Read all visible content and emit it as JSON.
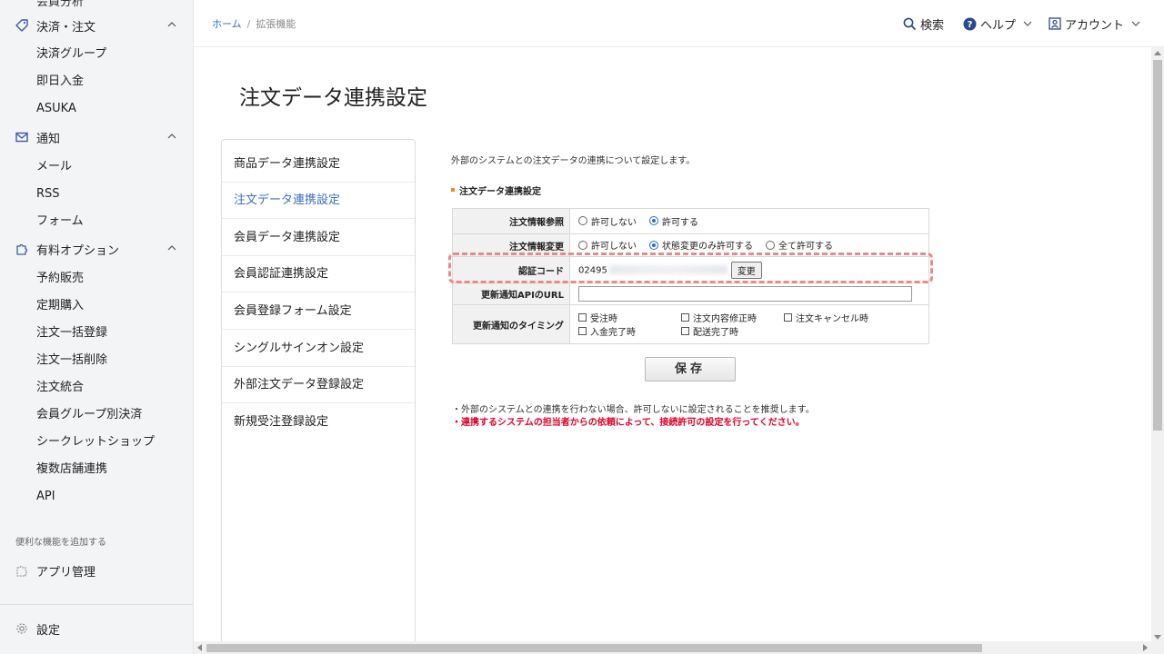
{
  "sidebar": {
    "top_cut": "会員分析",
    "groups": [
      {
        "label": "決済・注文",
        "icon": "tag-icon",
        "items": [
          "決済グループ",
          "即日入金",
          "ASUKA"
        ]
      },
      {
        "label": "通知",
        "icon": "mail-icon",
        "items": [
          "メール",
          "RSS",
          "フォーム"
        ]
      },
      {
        "label": "有料オプション",
        "icon": "puzzle-icon",
        "items": [
          "予約販売",
          "定期購入",
          "注文一括登録",
          "注文一括削除",
          "注文統合",
          "会員グループ別決済",
          "シークレットショップ",
          "複数店舗連携",
          "API"
        ]
      }
    ],
    "section_label": "便利な機能を追加する",
    "app_manage": "アプリ管理",
    "settings": "設定"
  },
  "header": {
    "breadcrumb_home": "ホーム",
    "breadcrumb_sep": "/",
    "breadcrumb_current": "拡張機能",
    "search": "検索",
    "help": "ヘルプ",
    "account": "アカウント"
  },
  "page": {
    "title": "注文データ連携設定"
  },
  "subnav": {
    "items": [
      "商品データ連携設定",
      "注文データ連携設定",
      "会員データ連携設定",
      "会員認証連携設定",
      "会員登録フォーム設定",
      "シングルサインオン設定",
      "外部注文データ登録設定",
      "新規受注登録設定"
    ],
    "active_index": 1
  },
  "content": {
    "intro": "外部のシステムとの注文データの連携について設定します。",
    "section_title": "注文データ連携設定",
    "rows": {
      "reference": {
        "label": "注文情報参照",
        "options": [
          "許可しない",
          "許可する"
        ],
        "selected": 1
      },
      "change": {
        "label": "注文情報変更",
        "options": [
          "許可しない",
          "状態変更のみ許可する",
          "全て許可する"
        ],
        "selected": 1
      },
      "auth": {
        "label": "認証コード",
        "value_prefix": "02495",
        "change_button": "変更"
      },
      "url": {
        "label": "更新通知APIのURL",
        "value": ""
      },
      "timing": {
        "label": "更新通知のタイミング",
        "options": [
          "受注時",
          "注文内容修正時",
          "注文キャンセル時",
          "入金完了時",
          "配送完了時"
        ]
      }
    },
    "save_button": "保存",
    "note1": "・外部のシステムとの連携を行わない場合、許可しないに設定されることを推奨します。",
    "note2": "・連携するシステムの担当者からの依頼によって、接続許可の設定を行ってください。"
  },
  "colors": {
    "accent": "#3b6fc4",
    "warning": "#e0002a",
    "highlight": "#e98a8a",
    "section_mark": "#f08a24"
  }
}
